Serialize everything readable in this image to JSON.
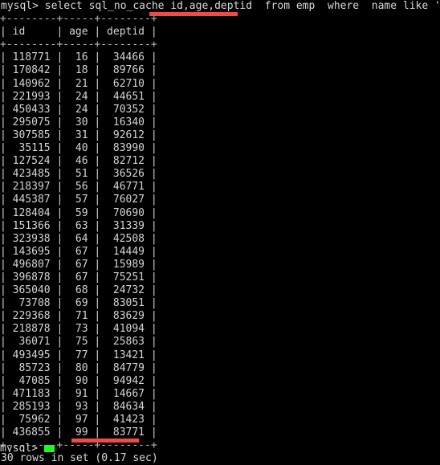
{
  "terminal": {
    "app": "mysql-client",
    "background_color": "#000000",
    "text_color": "#cccccc",
    "annotation_color": "#f04c46",
    "cursor_color": "#1aff1a",
    "prompt": "mysql>",
    "command_line": "mysql> select sql_no_cache id,age,deptid  from emp  where  name like '%abc';",
    "command": {
      "keyword_select": "select",
      "hint": "sql_no_cache",
      "columns": "id,age,deptid",
      "keyword_from": "from",
      "table": "emp",
      "keyword_where": "where",
      "predicate": "name like '%abc';"
    },
    "bottom_prompt_text": "mysql>"
  },
  "result_table": {
    "separator": "+--------+-----+--------+",
    "columns": [
      "id",
      "age",
      "deptid"
    ],
    "header_line": "| id     | age | deptid |",
    "rows": [
      {
        "id": "118771",
        "age": "16",
        "deptid": "34466"
      },
      {
        "id": "170842",
        "age": "18",
        "deptid": "89766"
      },
      {
        "id": "140962",
        "age": "21",
        "deptid": "62710"
      },
      {
        "id": "221993",
        "age": "24",
        "deptid": "44651"
      },
      {
        "id": "450433",
        "age": "24",
        "deptid": "70352"
      },
      {
        "id": "295075",
        "age": "30",
        "deptid": "16340"
      },
      {
        "id": "307585",
        "age": "31",
        "deptid": "92612"
      },
      {
        "id": "35115",
        "age": "40",
        "deptid": "83990"
      },
      {
        "id": "127524",
        "age": "46",
        "deptid": "82712"
      },
      {
        "id": "423485",
        "age": "51",
        "deptid": "36526"
      },
      {
        "id": "218397",
        "age": "56",
        "deptid": "46771"
      },
      {
        "id": "445387",
        "age": "57",
        "deptid": "76027"
      },
      {
        "id": "128404",
        "age": "59",
        "deptid": "70690"
      },
      {
        "id": "151366",
        "age": "63",
        "deptid": "31339"
      },
      {
        "id": "323938",
        "age": "64",
        "deptid": "42508"
      },
      {
        "id": "143695",
        "age": "67",
        "deptid": "14449"
      },
      {
        "id": "496807",
        "age": "67",
        "deptid": "15989"
      },
      {
        "id": "396878",
        "age": "67",
        "deptid": "75251"
      },
      {
        "id": "365040",
        "age": "68",
        "deptid": "24732"
      },
      {
        "id": "73708",
        "age": "69",
        "deptid": "83051"
      },
      {
        "id": "229368",
        "age": "71",
        "deptid": "83629"
      },
      {
        "id": "218878",
        "age": "73",
        "deptid": "41094"
      },
      {
        "id": "36071",
        "age": "75",
        "deptid": "25863"
      },
      {
        "id": "493495",
        "age": "77",
        "deptid": "13421"
      },
      {
        "id": "85723",
        "age": "80",
        "deptid": "84779"
      },
      {
        "id": "47085",
        "age": "90",
        "deptid": "94942"
      },
      {
        "id": "471183",
        "age": "91",
        "deptid": "14667"
      },
      {
        "id": "285193",
        "age": "93",
        "deptid": "84634"
      },
      {
        "id": "75962",
        "age": "97",
        "deptid": "41423"
      },
      {
        "id": "436855",
        "age": "99",
        "deptid": "83771"
      }
    ]
  },
  "result_footer": {
    "text": "30 rows in set (0.17 sec)",
    "row_count": 30,
    "duration": "0.17 sec"
  },
  "annotations": [
    {
      "name": "columns-underline",
      "target": "id,age,deptid",
      "color": "#f04c46"
    },
    {
      "name": "duration-underline",
      "target": "(0.17 sec)",
      "color": "#f04c46"
    }
  ]
}
